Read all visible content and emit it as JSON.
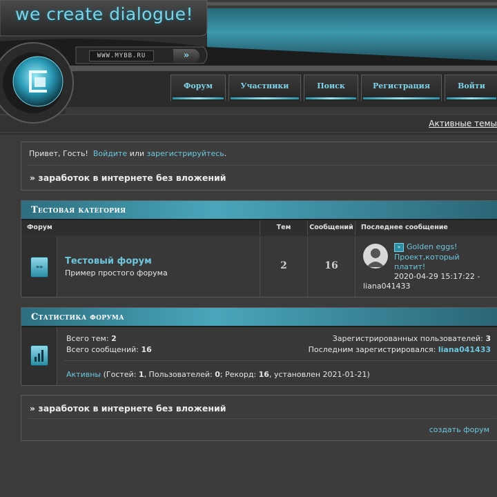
{
  "header": {
    "logo_text": "we create dialogue!",
    "site_url": "WWW.MYBB.RU",
    "arrow_glyph": "»",
    "nav": [
      "Форум",
      "Участники",
      "Поиск",
      "Регистрация",
      "Войти"
    ],
    "active_topics_link": "Активные темы"
  },
  "welcome": {
    "greeting": "Привет, Гость!",
    "login_link": "Войдите",
    "or": "или",
    "register_link": "зарегистрируйтесь",
    "period": ".",
    "banner": "» заработок в интернете без вложений"
  },
  "category": {
    "title": "Тестовая категория",
    "columns": {
      "forum": "Форум",
      "topics": "Тем",
      "posts": "Сообщений",
      "last_post": "Последнее сообщение"
    },
    "rows": [
      {
        "icon": "forum-arrow-icon",
        "name": "Тестовый форум",
        "description": "Пример простого форума",
        "topics": "2",
        "posts": "16",
        "last_post": {
          "title_line1": "Golden eggs!",
          "title_line2": "Проект,который",
          "title_line3": "платит!",
          "datetime": "2020-04-29 15:17:22 -",
          "author": "liana041433"
        }
      }
    ]
  },
  "stats": {
    "title": "Статистика форума",
    "total_topics_label": "Всего тем:",
    "total_topics": "2",
    "total_posts_label": "Всего сообщений:",
    "total_posts": "16",
    "registered_label": "Зарегистрированных пользователей:",
    "registered": "3",
    "last_registered_label": "Последним зарегистрировался:",
    "last_registered": "liana041433",
    "active_link": "Активны",
    "active_open": "(Гостей: ",
    "guests": "1",
    "users_label": ", Пользователей: ",
    "users": "0",
    "record_label": "; Рекорд: ",
    "record": "16",
    "established": ", установлен 2021-01-21)"
  },
  "footer": {
    "banner": "» заработок в интернете без вложений",
    "create_forum_link": "создать форум"
  },
  "colors": {
    "accent": "#6ec6dc",
    "header_bar": "#4aa6bb",
    "background": "#3b3b3b"
  }
}
